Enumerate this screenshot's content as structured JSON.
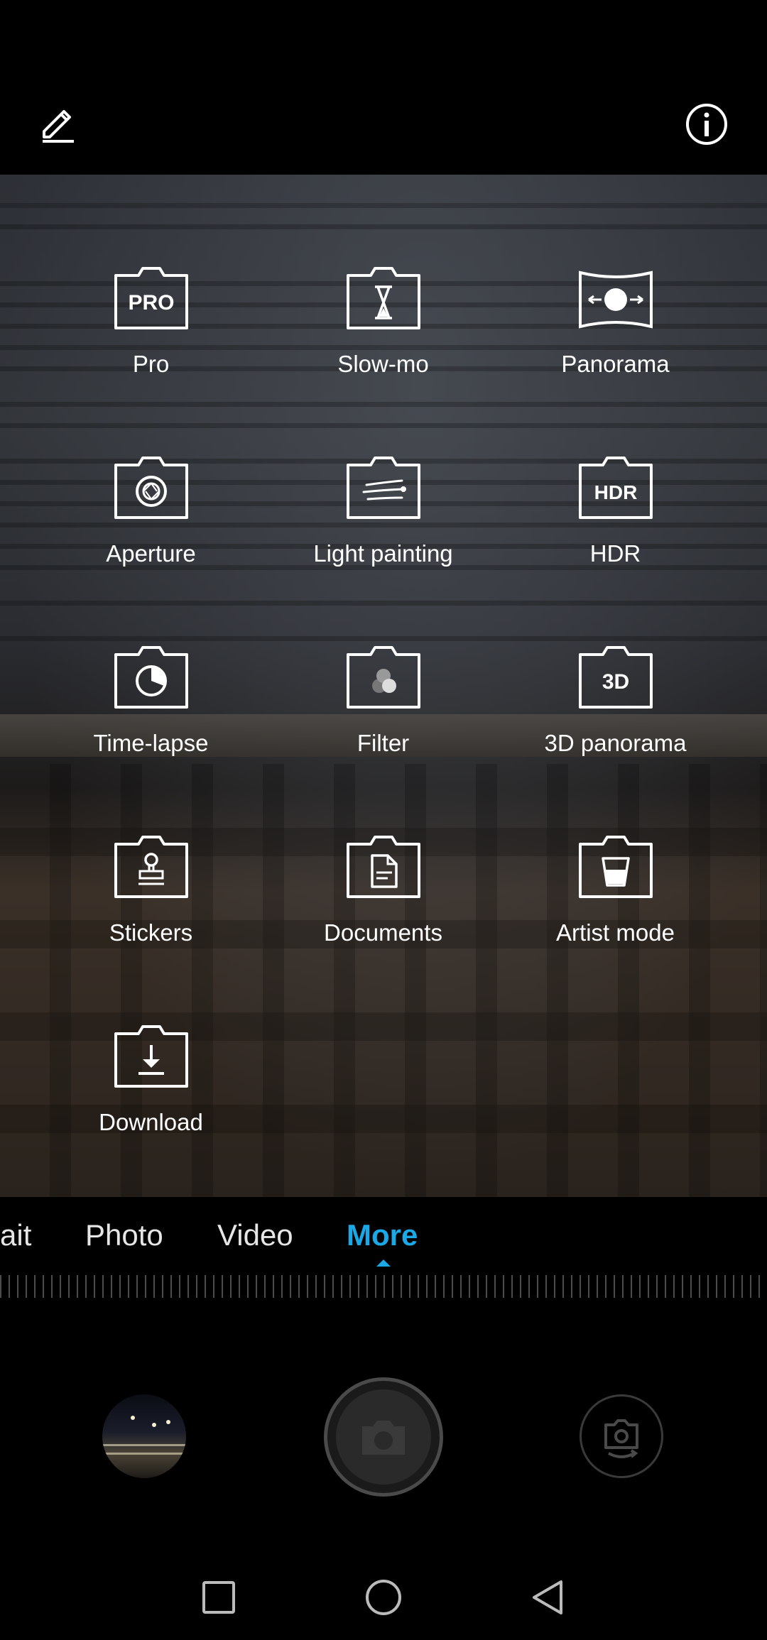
{
  "colors": {
    "accent": "#1aa8e6",
    "icon": "#ffffff",
    "background": "#000000"
  },
  "top_bar": {
    "edit_icon": "pencil-icon",
    "info_icon": "info-circle-icon"
  },
  "modes": [
    {
      "label": "Pro",
      "icon": "pro-icon",
      "icon_text": "PRO"
    },
    {
      "label": "Slow-mo",
      "icon": "hourglass-icon"
    },
    {
      "label": "Panorama",
      "icon": "panorama-icon"
    },
    {
      "label": "Aperture",
      "icon": "aperture-icon"
    },
    {
      "label": "Light painting",
      "icon": "light-painting-icon"
    },
    {
      "label": "HDR",
      "icon": "hdr-icon",
      "icon_text": "HDR"
    },
    {
      "label": "Time-lapse",
      "icon": "time-lapse-icon"
    },
    {
      "label": "Filter",
      "icon": "filter-icon"
    },
    {
      "label": "3D panorama",
      "icon": "3d-panorama-icon",
      "icon_text": "3D"
    },
    {
      "label": "Stickers",
      "icon": "stamp-icon"
    },
    {
      "label": "Documents",
      "icon": "document-icon"
    },
    {
      "label": "Artist mode",
      "icon": "artist-mode-icon"
    },
    {
      "label": "Download",
      "icon": "download-icon"
    }
  ],
  "mode_tabs": [
    {
      "label": "ait"
    },
    {
      "label": "Photo"
    },
    {
      "label": "Video"
    },
    {
      "label": "More",
      "active": true
    }
  ],
  "bottom_controls": {
    "gallery_icon": "gallery-thumbnail",
    "shutter_icon": "camera-shutter-icon",
    "switch_icon": "switch-camera-icon"
  },
  "nav_bar": {
    "recents_icon": "square-recents-icon",
    "home_icon": "circle-home-icon",
    "back_icon": "triangle-back-icon"
  }
}
